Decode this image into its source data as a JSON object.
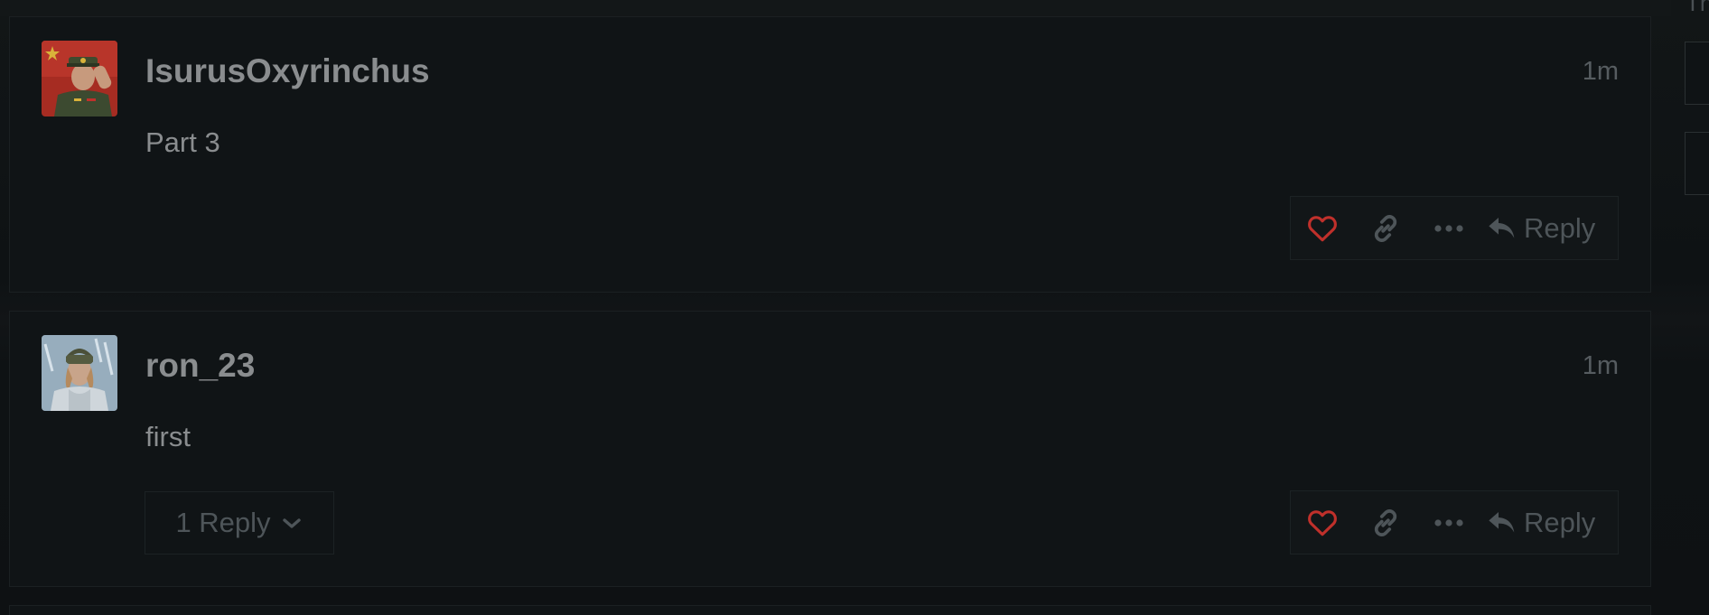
{
  "posts": [
    {
      "username": "IsurusOxyrinchus",
      "time": "1m",
      "body": "Part 3",
      "actions": {
        "reply_label": "Reply"
      },
      "avatar": "avatar-soldier-flag"
    },
    {
      "username": "ron_23",
      "time": "1m",
      "body": "first",
      "replies_toggle": "1 Reply",
      "actions": {
        "reply_label": "Reply"
      },
      "avatar": "avatar-winter-soldier"
    }
  ],
  "sidebar": {
    "text": "Th"
  },
  "colors": {
    "like": "#c0302b",
    "icon": "#4e5559",
    "text": "#8a8d8f",
    "muted": "#565c60"
  },
  "icons": [
    "heart-icon",
    "link-icon",
    "more-icon",
    "reply-icon",
    "chevron-down-icon"
  ]
}
